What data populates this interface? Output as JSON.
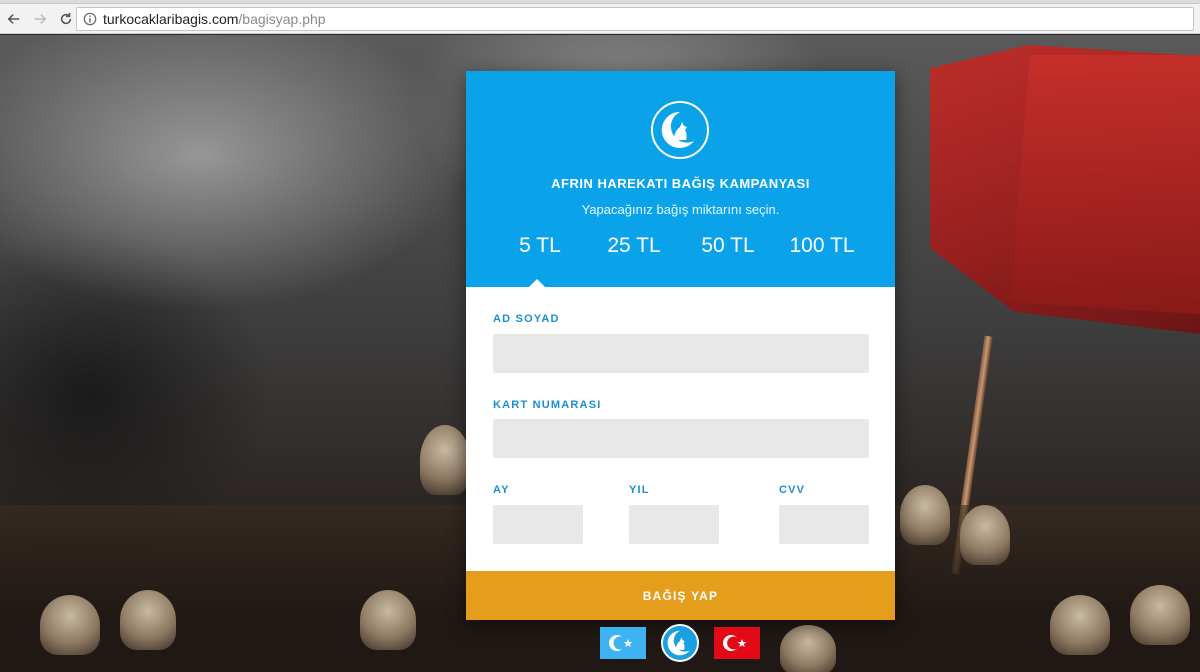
{
  "browser": {
    "url_host": "turkocaklaribagis.com",
    "url_path": "/bagisyap.php",
    "icons": [
      "back-arrow-icon",
      "forward-arrow-icon",
      "reload-icon",
      "info-icon"
    ]
  },
  "card": {
    "title": "AFRIN HAREKATI BAĞIŞ KAMPANYASI",
    "subtitle": "Yapacağınız bağış miktarını seçin.",
    "amounts": [
      "5 TL",
      "25 TL",
      "50 TL",
      "100 TL"
    ],
    "selected_amount": "5 TL",
    "colors": {
      "header": "#0aa3ea",
      "button": "#e49e1c",
      "label": "#1a8fcf"
    }
  },
  "form": {
    "name_label": "AD SOYAD",
    "name_value": "",
    "card_label": "KART NUMARASI",
    "card_value": "",
    "month_label": "AY",
    "month_value": "",
    "year_label": "YIL",
    "year_value": "",
    "cvv_label": "CVV",
    "cvv_value": ""
  },
  "submit_label": "BAĞIŞ YAP"
}
